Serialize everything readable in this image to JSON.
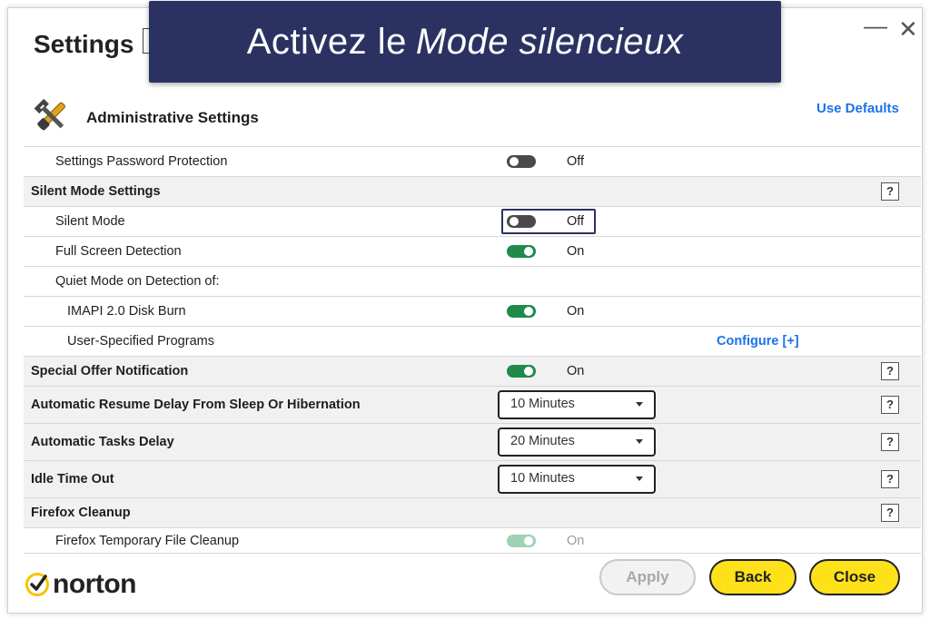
{
  "window": {
    "title": "Settings",
    "minimize_label": "—",
    "close_label": "✕"
  },
  "banner": {
    "text_plain": "Activez le",
    "text_italic": "Mode silencieux"
  },
  "admin": {
    "title": "Administrative Settings",
    "icon": "tools-icon",
    "use_defaults": "Use Defaults"
  },
  "help_label": "?",
  "rows": {
    "password_protection": {
      "label": "Settings Password Protection",
      "state": "Off"
    },
    "silent_mode_settings": {
      "label": "Silent Mode Settings"
    },
    "silent_mode": {
      "label": "Silent Mode",
      "state": "Off"
    },
    "full_screen_detection": {
      "label": "Full Screen Detection",
      "state": "On"
    },
    "quiet_mode_on": {
      "label": "Quiet Mode on Detection of:"
    },
    "imapi_disk_burn": {
      "label": "IMAPI 2.0 Disk Burn",
      "state": "On"
    },
    "user_programs": {
      "label": "User-Specified Programs",
      "configure": "Configure [+]"
    },
    "special_offer": {
      "label": "Special Offer Notification",
      "state": "On"
    },
    "resume_delay": {
      "label": "Automatic Resume Delay From Sleep Or Hibernation",
      "value": "10 Minutes"
    },
    "tasks_delay": {
      "label": "Automatic Tasks Delay",
      "value": "20 Minutes"
    },
    "idle_timeout": {
      "label": "Idle Time Out",
      "value": "10 Minutes"
    },
    "firefox_cleanup": {
      "label": "Firefox Cleanup"
    },
    "firefox_temp_cleanup": {
      "label": "Firefox Temporary File Cleanup",
      "state": "On"
    }
  },
  "footer": {
    "logo_text": "norton",
    "apply": "Apply",
    "back": "Back",
    "close": "Close"
  },
  "colors": {
    "banner_bg": "#2b3262",
    "toggle_on": "#1f8a4c",
    "toggle_off": "#4a4a4a",
    "link": "#1a73e8",
    "button_yellow": "#ffe11a",
    "logo_check": "#f5c400"
  }
}
